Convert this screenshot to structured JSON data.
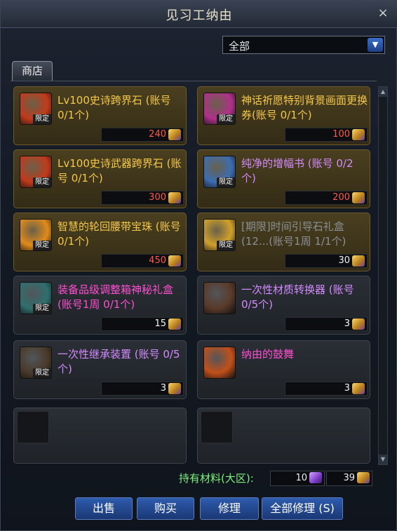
{
  "window": {
    "title": "见习工纳由",
    "close_symbol": "×"
  },
  "filter": {
    "selected": "全部",
    "arrow": "▼"
  },
  "tab": {
    "label": "商店"
  },
  "items": [
    {
      "name": "Lv100史诗跨界石 (账号 0/1个)",
      "price": "240",
      "price_color": "#ff5a4a",
      "name_color": "#f5c84a",
      "limited": "限定",
      "icon": "fire-stone-icon",
      "icon_color": "#c23a1a",
      "coin": "gold"
    },
    {
      "name": "神话祈愿特别背景画面更换券(账号 0/1个)",
      "price": "100",
      "price_color": "#ff5a4a",
      "name_color": "#f5c84a",
      "limited": "限定",
      "icon": "ticket-icon",
      "icon_color": "#b0308a",
      "coin": "gold"
    },
    {
      "name": "Lv100史诗武器跨界石 (账号 0/1个)",
      "price": "300",
      "price_color": "#ff5a4a",
      "name_color": "#f5c84a",
      "limited": "限定",
      "icon": "weapon-stone-icon",
      "icon_color": "#c23a1a",
      "coin": "gold"
    },
    {
      "name": "纯净的增幅书 (账号 0/2个)",
      "price": "200",
      "price_color": "#ff5a4a",
      "name_color": "#d58bff",
      "limited": "限定",
      "icon": "book-icon",
      "icon_color": "#3d6db0",
      "coin": "gold"
    },
    {
      "name": "智慧的轮回腰带宝珠 (账号 0/1个)",
      "price": "450",
      "price_color": "#ff5a4a",
      "name_color": "#f5c84a",
      "limited": "限定",
      "icon": "orb-icon",
      "icon_color": "#e08a1a",
      "coin": "gold"
    },
    {
      "name": "[期限]时间引导石礼盒 (12...(账号1周 1/1个)",
      "price": "30",
      "price_color": "#f4f4f4",
      "name_color": "#8b8f96",
      "limited": "限定",
      "icon": "gift-box-icon",
      "icon_color": "#d0a02a",
      "coin": "gold"
    },
    {
      "name": "装备品级调整箱神秘礼盒(账号1周 0/1个)",
      "price": "15",
      "price_color": "#f4f4f4",
      "name_color": "#ff4fd0",
      "limited": "限定",
      "icon": "chest-icon",
      "icon_color": "#2f6f6f",
      "coin": "gold"
    },
    {
      "name": "一次性材质转换器 (账号 0/5个)",
      "price": "3",
      "price_color": "#f4f4f4",
      "name_color": "#d58bff",
      "limited": "",
      "icon": "converter-icon",
      "icon_color": "#5a3a2a",
      "coin": "gold"
    },
    {
      "name": "一次性继承装置 (账号 0/5个)",
      "price": "3",
      "price_color": "#f4f4f4",
      "name_color": "#d58bff",
      "limited": "限定",
      "icon": "inherit-device-icon",
      "icon_color": "#4a3a2a",
      "coin": "gold"
    },
    {
      "name": "纳由的鼓舞",
      "price": "3",
      "price_color": "#f4f4f4",
      "name_color": "#ff4fd0",
      "limited": "",
      "icon": "encourage-icon",
      "icon_color": "#c2501a",
      "coin": "gold"
    }
  ],
  "materials": {
    "label": "持有材料(大区):",
    "purple_amount": "10",
    "gold_amount": "39"
  },
  "buttons": {
    "sell": "出售",
    "buy": "购买",
    "repair": "修理",
    "repair_all": "全部修理 (S)"
  }
}
